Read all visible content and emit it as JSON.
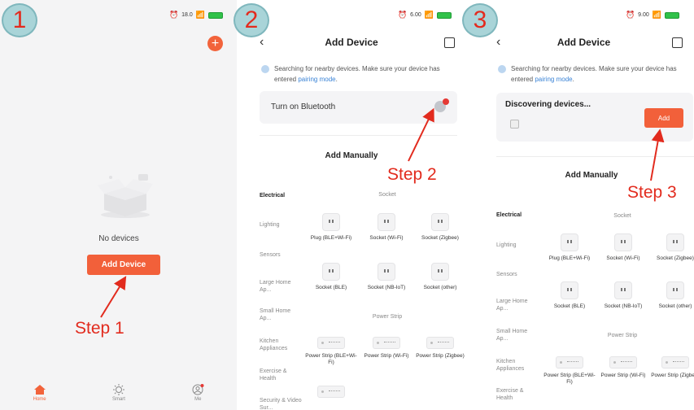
{
  "badges": [
    "1",
    "2",
    "3"
  ],
  "status": {
    "p1": {
      "speed": "18.0",
      "unit": "KB/S"
    },
    "p2": {
      "speed": "6.00",
      "unit": "KB/S"
    },
    "p3": {
      "speed": "9.00",
      "unit": "KB/S"
    }
  },
  "panel1": {
    "no_devices": "No devices",
    "add_device_button": "Add Device",
    "step": "Step 1",
    "tabs": [
      {
        "label": "Home",
        "icon": "home-icon",
        "active": true
      },
      {
        "label": "Smart",
        "icon": "sun-icon",
        "active": false
      },
      {
        "label": "Me",
        "icon": "profile-icon",
        "active": false
      }
    ]
  },
  "panel2": {
    "title": "Add Device",
    "searching_text": "Searching for nearby devices. Make sure your device has entered ",
    "pairing_link": "pairing mode",
    "period": ".",
    "bluetooth_label": "Turn on Bluetooth",
    "step": "Step 2",
    "add_manually": "Add Manually",
    "categories": [
      "Electrical",
      "Lighting",
      "Sensors",
      "Large Home Ap...",
      "Small Home Ap...",
      "Kitchen Appliances",
      "Exercise & Health",
      "Security & Video Sur..."
    ],
    "socket_header": "Socket",
    "power_strip_header": "Power Strip",
    "sockets_row1": [
      "Plug (BLE+Wi-Fi)",
      "Socket (Wi-Fi)",
      "Socket (Zigbee)"
    ],
    "sockets_row2": [
      "Socket (BLE)",
      "Socket (NB-IoT)",
      "Socket (other)"
    ],
    "strips_row1": [
      "Power Strip (BLE+Wi-Fi)",
      "Power Strip (Wi-Fi)",
      "Power Strip (Zigbee)"
    ]
  },
  "panel3": {
    "title": "Add Device",
    "discovering": "Discovering devices...",
    "add_button": "Add",
    "step": "Step 3",
    "add_manually": "Add Manually",
    "categories": [
      "Electrical",
      "Lighting",
      "Sensors",
      "Large Home Ap...",
      "Small Home Ap...",
      "Kitchen Appliances",
      "Exercise & Health"
    ]
  },
  "colors": {
    "accent": "#f2603a",
    "step_red": "#e22b1e",
    "badge_bg": "#a9d4d8",
    "link": "#3a83d6"
  }
}
